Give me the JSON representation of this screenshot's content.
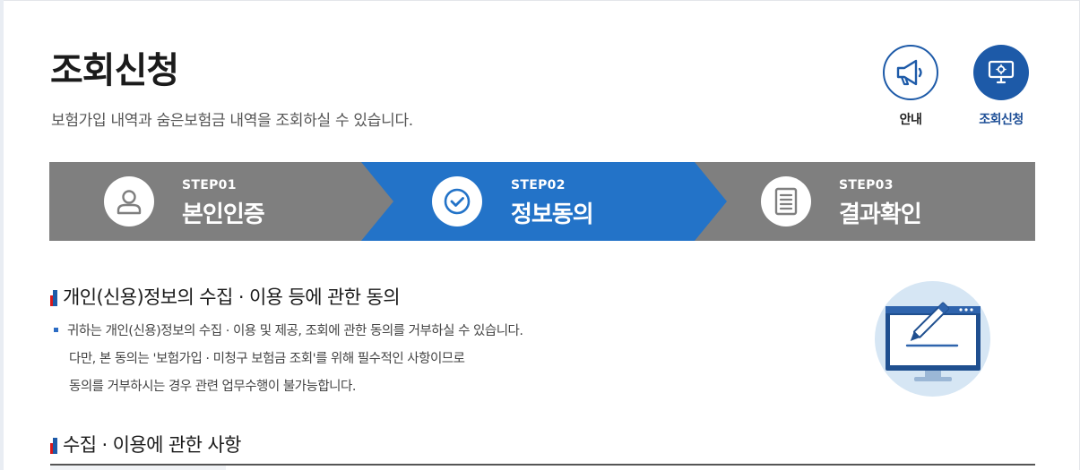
{
  "header": {
    "title": "조회신청",
    "subtitle": "보험가입 내역과 숨은보험금 내역을 조회하실 수 있습니다."
  },
  "top_actions": [
    {
      "label": "안내",
      "icon": "megaphone-icon"
    },
    {
      "label": "조회신청",
      "icon": "monitor-search-icon"
    }
  ],
  "steps": [
    {
      "number": "STEP01",
      "name": "본인인증",
      "icon": "person-icon",
      "active": false
    },
    {
      "number": "STEP02",
      "name": "정보동의",
      "icon": "check-circle-icon",
      "active": true
    },
    {
      "number": "STEP03",
      "name": "결과확인",
      "icon": "document-icon",
      "active": false
    }
  ],
  "colors": {
    "step_inactive": "#7f7f7f",
    "step_active": "#2373c8",
    "brand_blue": "#1d5aa8"
  },
  "consent_section": {
    "title": "개인(신용)정보의 수집 · 이용 등에 관한 동의",
    "lines": [
      "귀하는 개인(신용)정보의 수집 · 이용 및 제공, 조회에 관한 동의를 거부하실 수 있습니다.",
      "다만, 본 동의는 '보험가입 · 미청구 보험금 조회'를 위해 필수적인 사항이므로",
      "동의를 거부하시는 경우 관련 업무수행이 불가능합니다."
    ]
  },
  "collection_section": {
    "title": "수집 · 이용에 관한 사항"
  }
}
